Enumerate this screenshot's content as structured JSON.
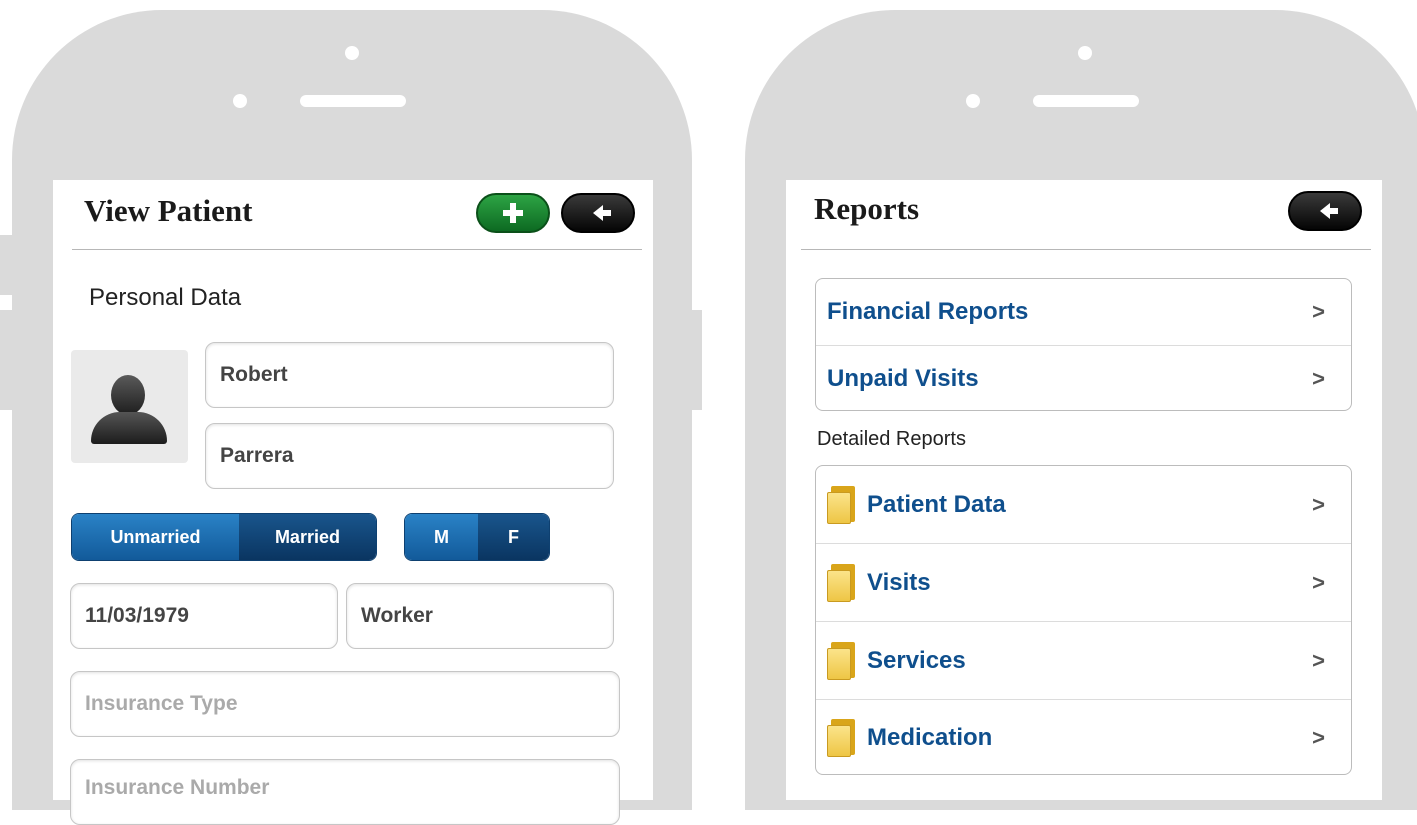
{
  "left_screen": {
    "title": "View Patient",
    "section_title": "Personal Data",
    "first_name": "Robert",
    "last_name": "Parrera",
    "marital_options": [
      "Unmarried",
      "Married"
    ],
    "marital_selected": "Unmarried",
    "gender_options": [
      "M",
      "F"
    ],
    "gender_selected": "M",
    "birth_date": "11/03/1979",
    "occupation": "Worker",
    "insurance_type_placeholder": "Insurance Type",
    "insurance_number_placeholder": "Insurance Number"
  },
  "right_screen": {
    "title": "Reports",
    "top_items": [
      {
        "label": "Financial Reports"
      },
      {
        "label": "Unpaid Visits"
      }
    ],
    "detailed_heading": "Detailed Reports",
    "detailed_items": [
      {
        "label": "Patient Data",
        "icon": "folder-icon"
      },
      {
        "label": "Visits",
        "icon": "folder-icon"
      },
      {
        "label": "Services",
        "icon": "folder-icon"
      },
      {
        "label": "Medication",
        "icon": "folder-icon"
      }
    ]
  },
  "colors": {
    "link_blue": "#0f4f8d",
    "add_green": "#1e8a36",
    "segment_blue": "#1a66a8",
    "phone_gray": "#dadada"
  }
}
